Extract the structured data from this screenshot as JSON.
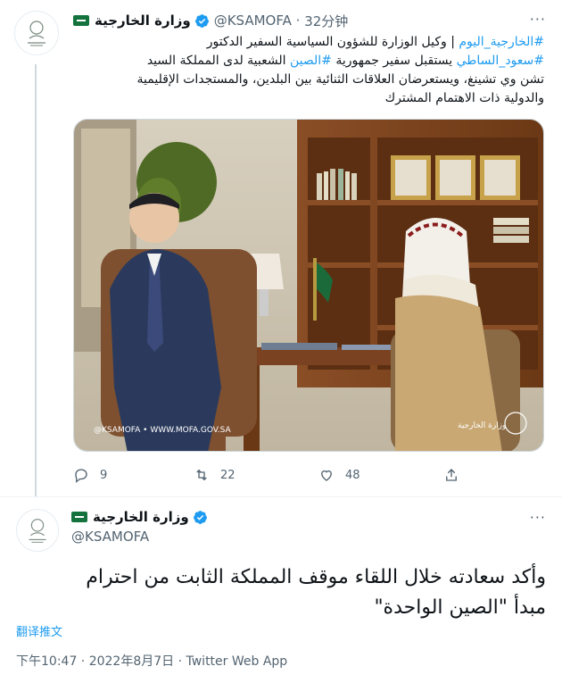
{
  "account": {
    "name": "وزارة الخارجية",
    "handle": "@KSAMOFA",
    "time": "32分钟"
  },
  "tweet1": {
    "line1_hash": "#الخارجية_اليوم",
    "line1_text": " | وكيل الوزارة للشؤون السياسية السفير الدكتور",
    "line2_hash": "#سعود_الساطي",
    "line2_text_a": " يستقبل سفير جمهورية ",
    "line2_hash2": "#الصين",
    "line2_text_b": " الشعبية لدى المملكة السيد",
    "line3": "تشن وي تشينغ، ويستعرضان العلاقات الثنائية بين البلدين، والمستجدات الإقليمية",
    "line4": "والدولية ذات الاهتمام المشترك",
    "photo_watermark": "@KSAMOFA • WWW.MOFA.GOV.SA",
    "photo_logo_text": "وزارة الخارجية"
  },
  "actions": {
    "replies": "9",
    "retweets": "22",
    "likes": "48"
  },
  "tweet2": {
    "text_line1": "وأكد سعادته خلال اللقاء موقف المملكة الثابت من احترام",
    "text_line2": "مبدأ \"الصين الواحدة\"",
    "translate": "翻译推文",
    "timestamp": "下午10:47 · 2022年8月7日 · Twitter Web App"
  },
  "colors": {
    "accent": "#1d9bf0",
    "muted": "#536471",
    "flag": "#14723d"
  }
}
